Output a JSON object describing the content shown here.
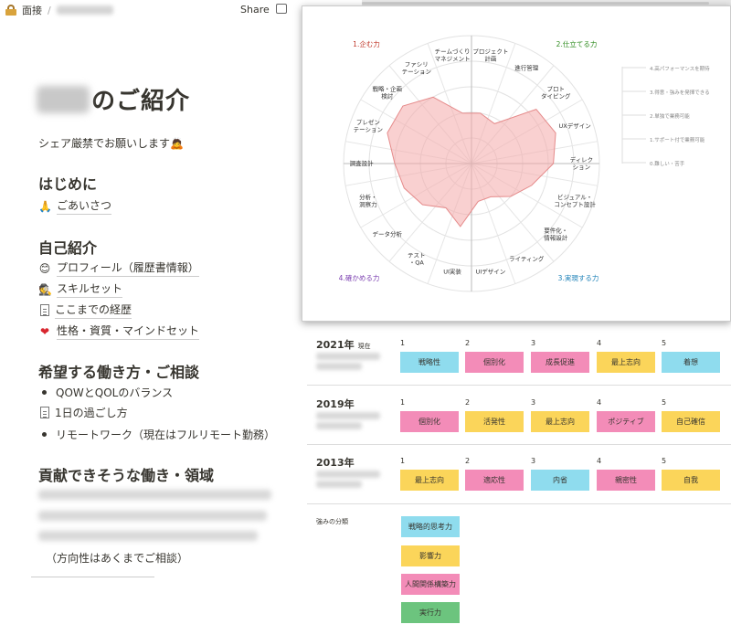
{
  "topbar": {
    "title": "面接",
    "separator": "/",
    "share_label": "Share"
  },
  "doc": {
    "title_suffix": "のご紹介",
    "subtitle": "シェア厳禁でお願いします🙇",
    "section_intro": "はじめに",
    "intro_link": "ごあいさつ",
    "section_self": "自己紹介",
    "self_links": [
      {
        "emoji": "😊",
        "label": "プロフィール（履歴書情報）"
      },
      {
        "emoji": "🕵",
        "label": "スキルセット"
      },
      {
        "icon": "page",
        "label": "ここまでの経歴"
      },
      {
        "emoji": "❤️",
        "label": "性格・資質・マインドセット"
      }
    ],
    "section_work": "希望する働き方・ご相談",
    "work_items": [
      {
        "type": "bullet",
        "label": "QOWとQOLのバランス"
      },
      {
        "type": "page",
        "label": "1日の過ごし方"
      },
      {
        "type": "bullet",
        "label": "リモートワーク（現在はフルリモート勤務）"
      }
    ],
    "section_contrib": "貢献できそうな働き・領域",
    "contrib_note": "（方向性はあくまでご相談）"
  },
  "radar": {
    "quadrants": [
      {
        "label": "1.企む力",
        "color": "#c0392b"
      },
      {
        "label": "2.仕立てる力",
        "color": "#2e8b1e"
      },
      {
        "label": "3.実現する力",
        "color": "#1f82b8"
      },
      {
        "label": "4.確かめる力",
        "color": "#7b3fb0"
      }
    ],
    "axes": [
      "プロジェクト\n計画",
      "進行管理",
      "プロト\nタイピング",
      "UXデザイン",
      "ディレク\nション",
      "ビジュアル・\nコンセプト設計",
      "要件化・\n情報設計",
      "ライティング",
      "UIデザイン",
      "UI実装",
      "テスト\n・QA",
      "データ分析",
      "分析・\n洞察力",
      "調査設計",
      "プレゼン\nテーション",
      "戦略・企画\n検討",
      "ファシリ\nテーション",
      "チームづくり\nマネジメント"
    ],
    "values": [
      2.0,
      1.8,
      3.3,
      3.5,
      3.2,
      2.5,
      2.0,
      1.5,
      1.5,
      2.5,
      2.0,
      2.5,
      2.8,
      3.0,
      3.5,
      3.5,
      3.0,
      2.0
    ],
    "max": 5,
    "levels": [
      "4.高パフォーマンスを期待",
      "3.得意・強みを発揮できる",
      "2.単独で業務可能",
      "1.サポート付で業務可能",
      "0.難しい・苦手"
    ]
  },
  "strengths": {
    "rows": [
      {
        "year": "2021年",
        "tag": "現在",
        "items": [
          {
            "label": "戦略性",
            "color": "#8fdcee"
          },
          {
            "label": "個別化",
            "color": "#f38cb8"
          },
          {
            "label": "成長促進",
            "color": "#f38cb8"
          },
          {
            "label": "最上志向",
            "color": "#fbd55a"
          },
          {
            "label": "着想",
            "color": "#8fdcee"
          }
        ]
      },
      {
        "year": "2019年",
        "tag": "",
        "items": [
          {
            "label": "個別化",
            "color": "#f38cb8"
          },
          {
            "label": "活発性",
            "color": "#fbd55a"
          },
          {
            "label": "最上志向",
            "color": "#fbd55a"
          },
          {
            "label": "ポジティブ",
            "color": "#f38cb8"
          },
          {
            "label": "自己確信",
            "color": "#fbd55a"
          }
        ]
      },
      {
        "year": "2013年",
        "tag": "",
        "items": [
          {
            "label": "最上志向",
            "color": "#fbd55a"
          },
          {
            "label": "適応性",
            "color": "#f38cb8"
          },
          {
            "label": "内省",
            "color": "#8fdcee"
          },
          {
            "label": "親密性",
            "color": "#f38cb8"
          },
          {
            "label": "自我",
            "color": "#fbd55a"
          }
        ]
      }
    ],
    "ranks": [
      "1",
      "2",
      "3",
      "4",
      "5"
    ],
    "category_title": "強みの分類",
    "categories": [
      {
        "label": "戦略的思考力",
        "color": "#8fdcee"
      },
      {
        "label": "影響力",
        "color": "#fbd55a"
      },
      {
        "label": "人間関係構築力",
        "color": "#f38cb8"
      },
      {
        "label": "実行力",
        "color": "#6cc47e"
      }
    ]
  }
}
